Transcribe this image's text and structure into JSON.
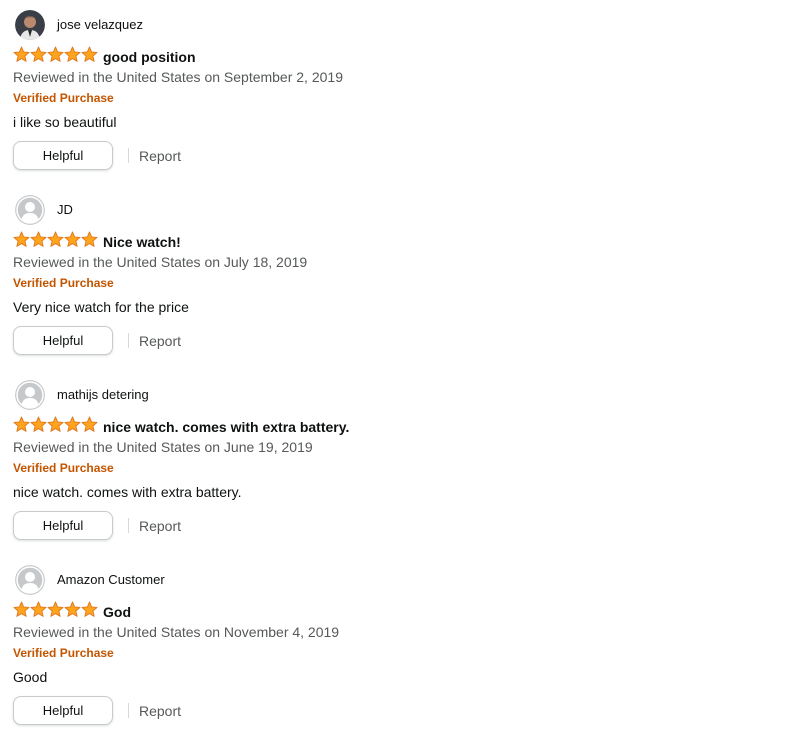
{
  "colors": {
    "star": "#ffa41c",
    "star_outline": "#de7921",
    "verified": "#c45500",
    "secondary_text": "#565959",
    "primary_text": "#0f1111"
  },
  "reviews": [
    {
      "author": "jose velazquez",
      "avatar": "profile-photo",
      "rating": 5,
      "title": "good position",
      "date": "Reviewed in the United States on September 2, 2019",
      "verified": "Verified Purchase",
      "body": "i like so beautiful",
      "helpful_label": "Helpful",
      "report_label": "Report"
    },
    {
      "author": "JD",
      "avatar": "default-avatar",
      "rating": 5,
      "title": "Nice watch!",
      "date": "Reviewed in the United States on July 18, 2019",
      "verified": "Verified Purchase",
      "body": "Very nice watch for the price",
      "helpful_label": "Helpful",
      "report_label": "Report"
    },
    {
      "author": "mathijs detering",
      "avatar": "default-avatar",
      "rating": 5,
      "title": "nice watch. comes with extra battery.",
      "date": "Reviewed in the United States on June 19, 2019",
      "verified": "Verified Purchase",
      "body": "nice watch. comes with extra battery.",
      "helpful_label": "Helpful",
      "report_label": "Report"
    },
    {
      "author": "Amazon Customer",
      "avatar": "default-avatar",
      "rating": 5,
      "title": "God",
      "date": "Reviewed in the United States on November 4, 2019",
      "verified": "Verified Purchase",
      "body": "Good",
      "helpful_label": "Helpful",
      "report_label": "Report"
    }
  ]
}
